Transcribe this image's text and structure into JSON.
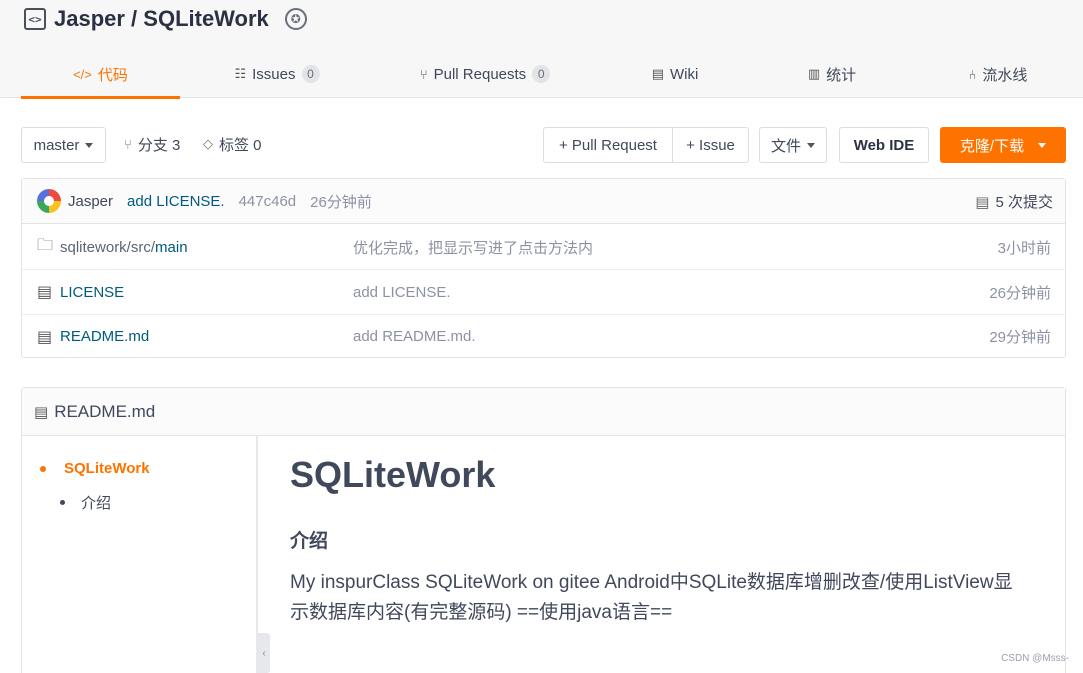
{
  "repo": {
    "path": "Jasper / SQLiteWork",
    "icon": "code-bracket-icon",
    "badge_icon": "recommend-badge-icon"
  },
  "tabs": [
    {
      "label": "代码",
      "icon": "code-icon",
      "active": true
    },
    {
      "label": "Issues",
      "icon": "issues-icon",
      "count": "0"
    },
    {
      "label": "Pull Requests",
      "icon": "pull-request-icon",
      "count": "0"
    },
    {
      "label": "Wiki",
      "icon": "wiki-book-icon"
    },
    {
      "label": "统计",
      "icon": "bar-chart-icon"
    },
    {
      "label": "流水线",
      "icon": "pipeline-icon"
    }
  ],
  "toolbar": {
    "branch": "master",
    "branches": "分支 3",
    "tags": "标签 0",
    "pull_request": "+ Pull Request",
    "issue": "+ Issue",
    "files": "文件",
    "web_ide": "Web IDE",
    "clone": "克隆/下载"
  },
  "latest_commit": {
    "author": "Jasper",
    "message": "add LICENSE.",
    "sha": "447c46d",
    "time": "26分钟前",
    "commit_count": "5 次提交"
  },
  "files": [
    {
      "type": "folder",
      "path_prefix": "sqlitework/src/",
      "name": "main",
      "message": "优化完成，把显示写进了点击方法内",
      "time": "3小时前"
    },
    {
      "type": "file",
      "path_prefix": "",
      "name": "LICENSE",
      "message": "add LICENSE.",
      "time": "26分钟前"
    },
    {
      "type": "file",
      "path_prefix": "",
      "name": "README.md",
      "message": "add README.md.",
      "time": "29分钟前"
    }
  ],
  "readme": {
    "filename": "README.md",
    "toc": [
      "SQLiteWork",
      "介绍"
    ],
    "title": "SQLiteWork",
    "section": "介绍",
    "body": "My inspurClass SQLiteWork on gitee Android中SQLite数据库增删改查/使用ListView显示数据库内容(有完整源码) ==使用java语言=="
  },
  "watermark": "CSDN @Msss-",
  "colors": {
    "accent": "#fe7300",
    "link": "#005980",
    "muted": "#8c92a4"
  }
}
